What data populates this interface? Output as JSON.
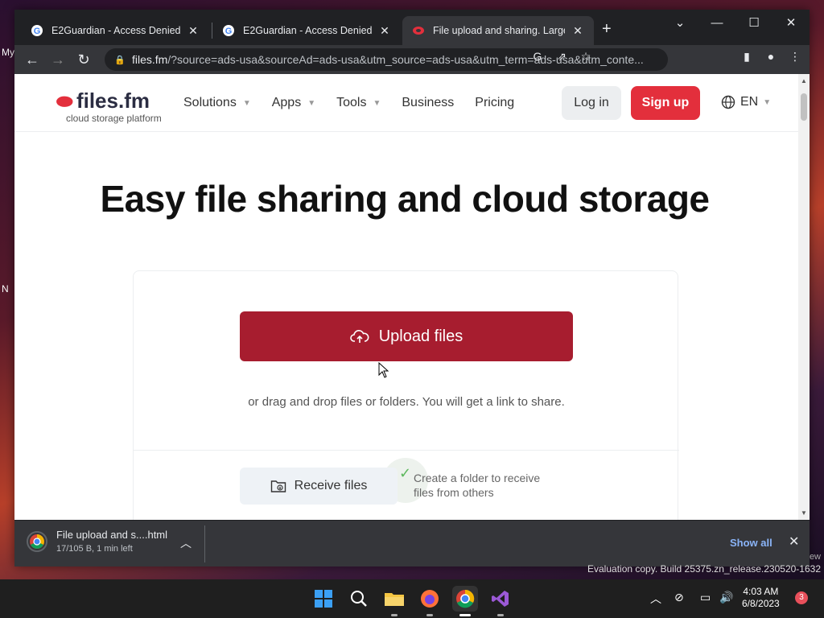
{
  "desktop": {
    "fragments": [
      "My",
      "N"
    ]
  },
  "browser": {
    "tabs": [
      {
        "title": "E2Guardian - Access Denied"
      },
      {
        "title": "E2Guardian - Access Denied"
      },
      {
        "title": "File upload and sharing. Large fil"
      }
    ],
    "address": {
      "host": "files.fm",
      "rest": "/?source=ads-usa&sourceAd=ads-usa&utm_source=ads-usa&utm_term=ads-usa&utm_conte..."
    }
  },
  "site": {
    "logo": {
      "name": "files.fm",
      "tagline": "cloud storage platform"
    },
    "nav": [
      {
        "label": "Solutions",
        "dropdown": true
      },
      {
        "label": "Apps",
        "dropdown": true
      },
      {
        "label": "Tools",
        "dropdown": true
      },
      {
        "label": "Business",
        "dropdown": false
      },
      {
        "label": "Pricing",
        "dropdown": false
      }
    ],
    "login_label": "Log in",
    "signup_label": "Sign up",
    "language": "EN",
    "hero_title": "Easy file sharing and cloud storage",
    "upload_label": "Upload files",
    "drag_hint": "or drag and drop files or folders. You will get a link to share.",
    "receive_label": "Receive files",
    "receive_desc_line1": "Create a folder to receive",
    "receive_desc_line2": "files from others"
  },
  "downloads": {
    "file_name": "File upload and s....html",
    "status": "17/105 B, 1 min left",
    "show_all": "Show all"
  },
  "system": {
    "eval_text": "Evaluation copy. Build 25375.zn_release.230520-1632",
    "eval_fragment": "ew",
    "time": "4:03 AM",
    "date": "6/8/2023",
    "notifications": "3"
  },
  "colors": {
    "brand_red": "#e32f3c",
    "upload_red": "#a71d2f",
    "chrome_dark": "#202124"
  }
}
